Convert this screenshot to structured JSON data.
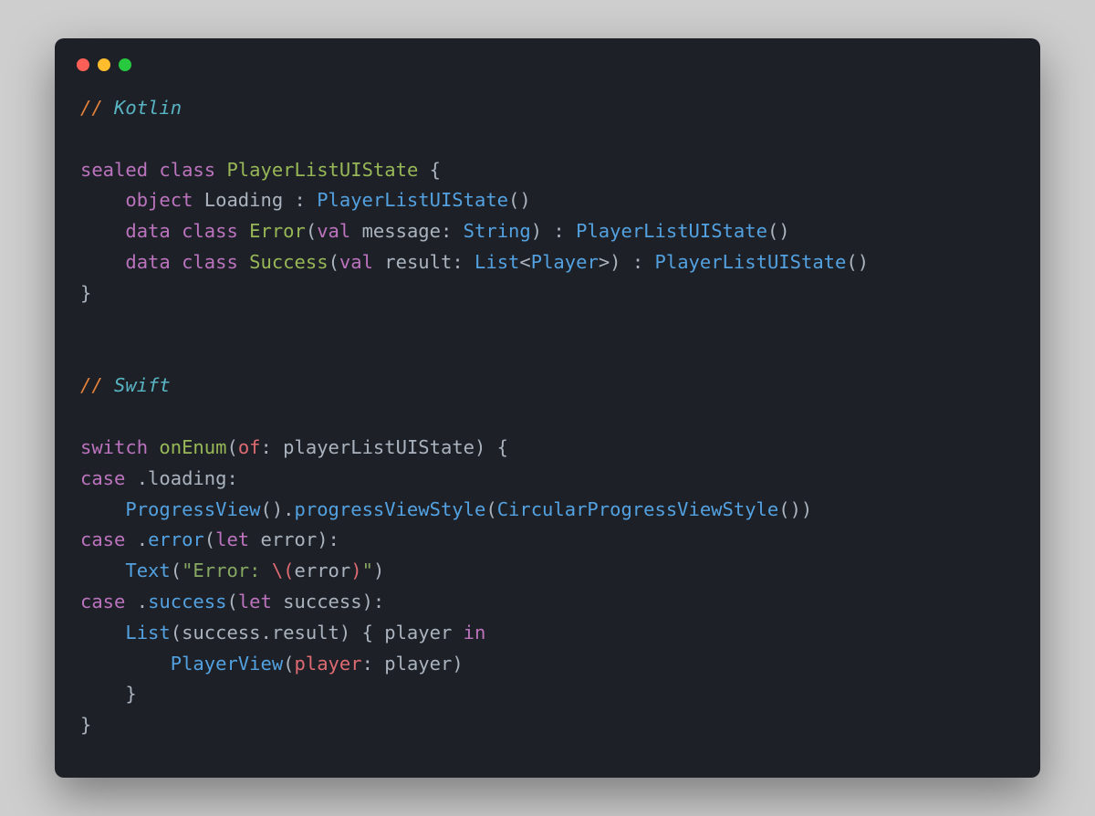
{
  "lines": {
    "l1_a": "// ",
    "l1_b": "Kotlin",
    "l3_a": "sealed",
    "l3_b": " class ",
    "l3_c": "PlayerListUIState",
    "l3_d": " {",
    "l4_a": "    object",
    "l4_b": " Loading : ",
    "l4_c": "PlayerListUIState",
    "l4_d": "()",
    "l5_a": "    data",
    "l5_b": " class ",
    "l5_c": "Error",
    "l5_d": "(",
    "l5_e": "val",
    "l5_f": " message: ",
    "l5_g": "String",
    "l5_h": ") : ",
    "l5_i": "PlayerListUIState",
    "l5_j": "()",
    "l6_a": "    data",
    "l6_b": " class ",
    "l6_c": "Success",
    "l6_d": "(",
    "l6_e": "val",
    "l6_f": " result: ",
    "l6_g": "List",
    "l6_h": "<",
    "l6_i": "Player",
    "l6_j": ">) : ",
    "l6_k": "PlayerListUIState",
    "l6_l": "()",
    "l7_a": "}",
    "l10_a": "// ",
    "l10_b": "Swift",
    "l12_a": "switch",
    "l12_b": " onEnum",
    "l12_c": "(",
    "l12_d": "of",
    "l12_e": ": playerListUIState) {",
    "l13_a": "case",
    "l13_b": " .loading:",
    "l14_a": "    ProgressView",
    "l14_b": "().",
    "l14_c": "progressViewStyle",
    "l14_d": "(",
    "l14_e": "CircularProgressViewStyle",
    "l14_f": "())",
    "l15_a": "case",
    "l15_b": " .",
    "l15_c": "error",
    "l15_d": "(",
    "l15_e": "let",
    "l15_f": " error):",
    "l16_a": "    Text",
    "l16_b": "(",
    "l16_c": "\"Error: ",
    "l16_d": "\\(",
    "l16_e": "error",
    "l16_f": ")",
    "l16_g": "\"",
    "l16_h": ")",
    "l17_a": "case",
    "l17_b": " .",
    "l17_c": "success",
    "l17_d": "(",
    "l17_e": "let",
    "l17_f": " success):",
    "l18_a": "    List",
    "l18_b": "(success.result) { player ",
    "l18_c": "in",
    "l19_a": "        PlayerView",
    "l19_b": "(",
    "l19_c": "player",
    "l19_d": ": player)",
    "l20_a": "    }",
    "l21_a": "}"
  }
}
